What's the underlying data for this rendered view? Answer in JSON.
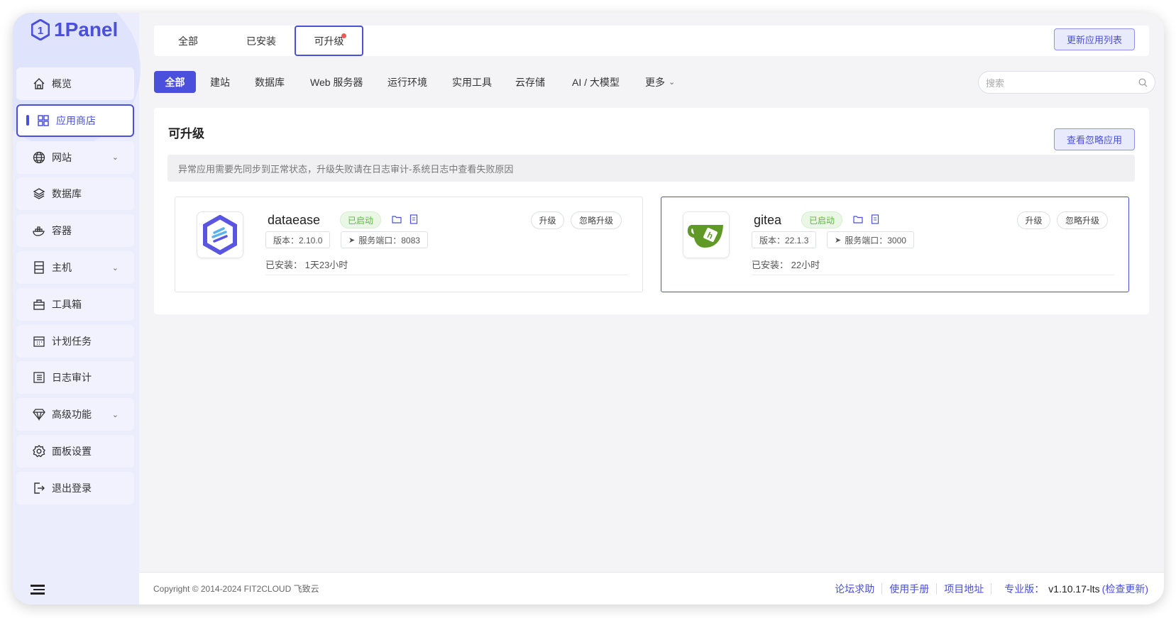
{
  "brand": {
    "name": "1Panel"
  },
  "sidebar": {
    "items": [
      {
        "label": "概览",
        "icon": "home-icon"
      },
      {
        "label": "应用商店",
        "icon": "apps-grid-icon",
        "active": true
      },
      {
        "label": "网站",
        "icon": "globe-icon",
        "expandable": true
      },
      {
        "label": "数据库",
        "icon": "layers-icon"
      },
      {
        "label": "容器",
        "icon": "docker-icon"
      },
      {
        "label": "主机",
        "icon": "server-icon",
        "expandable": true
      },
      {
        "label": "工具箱",
        "icon": "toolbox-icon"
      },
      {
        "label": "计划任务",
        "icon": "calendar-icon"
      },
      {
        "label": "日志审计",
        "icon": "log-icon"
      },
      {
        "label": "高级功能",
        "icon": "diamond-icon",
        "expandable": true
      },
      {
        "label": "面板设置",
        "icon": "gear-icon"
      },
      {
        "label": "退出登录",
        "icon": "logout-icon"
      }
    ]
  },
  "tabs": [
    {
      "label": "全部"
    },
    {
      "label": "已安装"
    },
    {
      "label": "可升级",
      "active": true
    }
  ],
  "update_list_label": "更新应用列表",
  "categories": [
    "全部",
    "建站",
    "数据库",
    "Web 服务器",
    "运行环境",
    "实用工具",
    "云存储",
    "AI / 大模型",
    "更多"
  ],
  "search": {
    "placeholder": "搜索"
  },
  "content": {
    "title": "可升级",
    "view_ignored_label": "查看忽略应用",
    "alert": "异常应用需要先同步到正常状态，升级失败请在日志审计-系统日志中查看失败原因",
    "apps": [
      {
        "name": "dataease",
        "status": "已启动",
        "version": "版本：2.10.0",
        "port": "服务端口：8083",
        "installed": "已安装：  1天23小时",
        "upgrade": "升级",
        "ignore": "忽略升级"
      },
      {
        "name": "gitea",
        "status": "已启动",
        "version": "版本：22.1.3",
        "port": "服务端口：3000",
        "installed": "已安装：  22小时",
        "upgrade": "升级",
        "ignore": "忽略升级"
      }
    ]
  },
  "footer": {
    "copyright": "Copyright © 2014-2024 FIT2CLOUD 飞致云",
    "links": [
      "论坛求助",
      "使用手册",
      "项目地址"
    ],
    "edition": "专业版：",
    "version": "v1.10.17-lts",
    "check_update": "(检查更新)"
  },
  "colors": {
    "accent": "#4a4fdc",
    "success": "#5cb83c",
    "badge_dot": "#f05a55"
  }
}
